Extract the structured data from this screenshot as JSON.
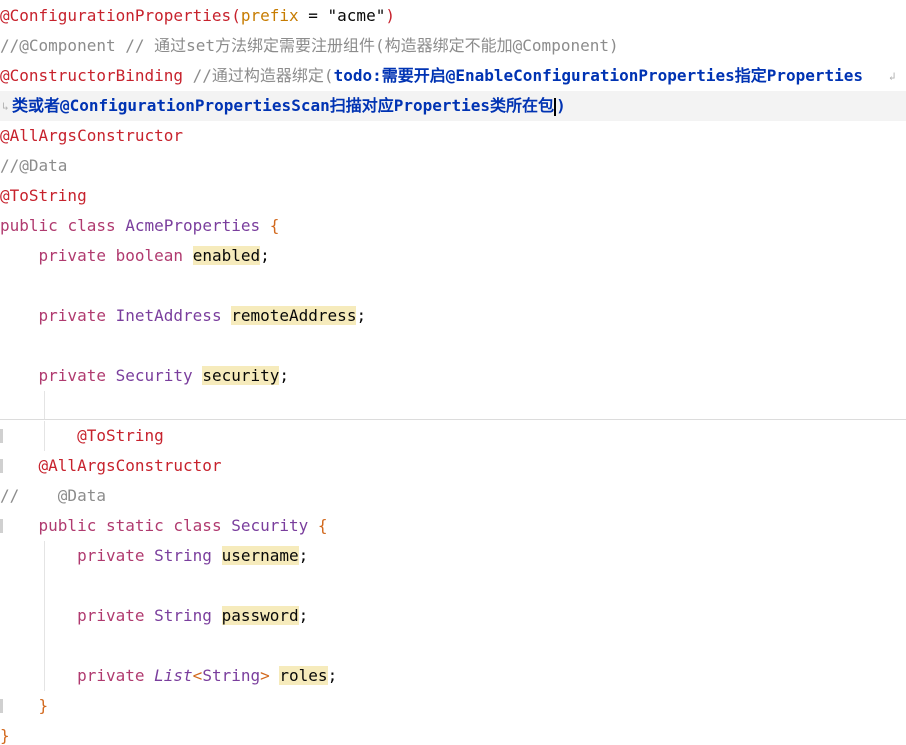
{
  "lines": {
    "l1": {
      "annotation": "@ConfigurationProperties",
      "open": "(",
      "param": "prefix",
      "eq": " = ",
      "str": "\"acme\"",
      "close": ")"
    },
    "l2": {
      "comment": "//@Component // 通过set方法绑定需要注册组件(构造器绑定不能加@Component)"
    },
    "l3": {
      "annotation": "@ConstructorBinding",
      "comment": " //通过构造器绑定(",
      "todo": "todo:需要开启@EnableConfigurationProperties指定Properties"
    },
    "l4": {
      "todo": "类或者@ConfigurationPropertiesScan扫描对应Properties类所在包",
      "close": ")"
    },
    "l5": {
      "annotation": "@AllArgsConstructor"
    },
    "l6": {
      "comment": "//@Data"
    },
    "l7": {
      "annotation": "@ToString"
    },
    "l8": {
      "kw1": "public",
      "kw2": "class",
      "type": "AcmeProperties",
      "brace": "{"
    },
    "l9": {
      "kw": "private",
      "type": "boolean",
      "ident": "enabled",
      "semi": ";"
    },
    "l11": {
      "kw": "private",
      "type": "InetAddress",
      "ident": "remoteAddress",
      "semi": ";"
    },
    "l13": {
      "kw": "private",
      "type": "Security",
      "ident": "security",
      "semi": ";"
    },
    "l15": {
      "annotation": "@ToString"
    },
    "l16": {
      "annotation": "@AllArgsConstructor"
    },
    "l17": {
      "comment_prefix": "//",
      "annotation": "@Data"
    },
    "l18": {
      "kw1": "public",
      "kw2": "static",
      "kw3": "class",
      "type": "Security",
      "brace": "{"
    },
    "l19": {
      "kw": "private",
      "type": "String",
      "ident": "username",
      "semi": ";"
    },
    "l21": {
      "kw": "private",
      "type": "String",
      "ident": "password",
      "semi": ";"
    },
    "l23": {
      "kw": "private",
      "type": "List",
      "generic_open": "<",
      "generic_type": "String",
      "generic_close": ">",
      "ident": "roles",
      "semi": ";"
    },
    "l24": {
      "brace": "}"
    },
    "l25": {
      "brace": "}"
    }
  }
}
